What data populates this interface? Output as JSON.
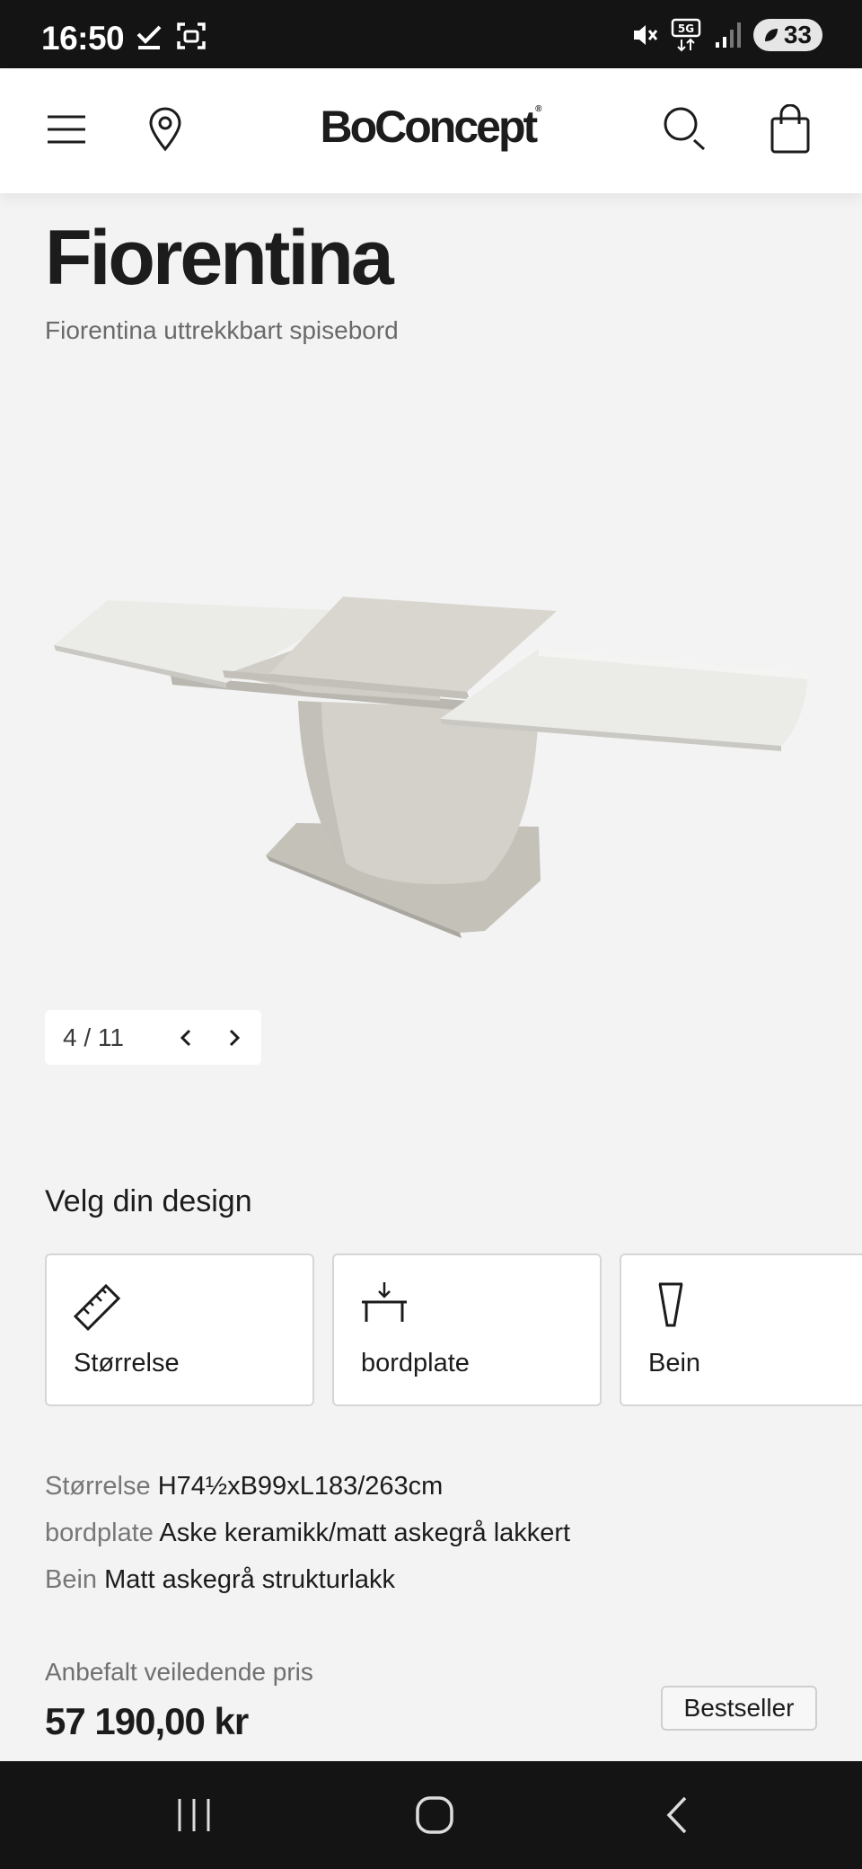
{
  "status_bar": {
    "time": "16:50",
    "network": "5G",
    "battery": "33",
    "icons": [
      "check-icon",
      "screenshot-icon",
      "mute-icon",
      "network-5g-icon",
      "signal-icon",
      "battery-icon"
    ]
  },
  "header": {
    "logo": "BoConcept",
    "logo_mark": "®",
    "icons": [
      "menu-icon",
      "location-pin-icon",
      "search-icon",
      "shopping-bag-icon"
    ]
  },
  "product": {
    "title": "Fiorentina",
    "subtitle": "Fiorentina uttrekkbart spisebord"
  },
  "gallery": {
    "current": "4",
    "total": "11",
    "separator": "/"
  },
  "design": {
    "section_title": "Velg din design",
    "cards": [
      {
        "label": "Størrelse",
        "icon": "ruler-icon"
      },
      {
        "label": "bordplate",
        "icon": "tabletop-icon"
      },
      {
        "label": "Bein",
        "icon": "leg-icon"
      }
    ]
  },
  "specs": [
    {
      "key": "Størrelse",
      "value": "H74½xB99xL183/263cm"
    },
    {
      "key": "bordplate",
      "value": "Aske keramikk/matt askegrå lakkert"
    },
    {
      "key": "Bein",
      "value": "Matt askegrå strukturlakk"
    }
  ],
  "pricing": {
    "label": "Anbefalt veiledende pris",
    "price": "57 190,00 kr",
    "badge": "Bestseller"
  },
  "colors": {
    "background": "#f3f3f3",
    "bars": "#141414",
    "text": "#1c1c1c",
    "muted": "#6a6a6a",
    "table_top": "#eae9e5",
    "table_base": "#cfcdc4"
  },
  "nav_bar": {
    "icons": [
      "recent-apps-icon",
      "home-icon",
      "back-icon"
    ]
  }
}
